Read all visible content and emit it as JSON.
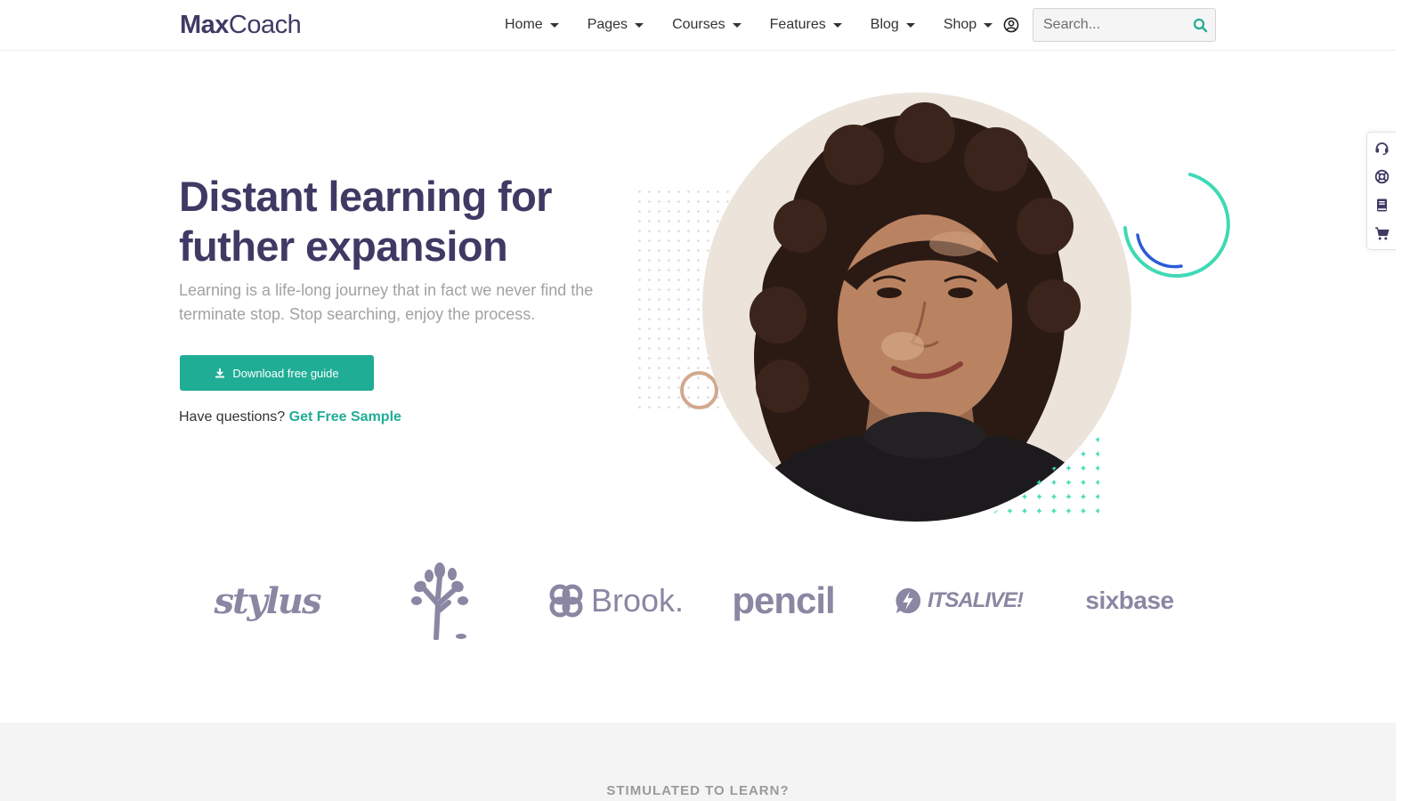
{
  "header": {
    "logo_bold": "Max",
    "logo_light": "Coach",
    "nav": [
      "Home",
      "Pages",
      "Courses",
      "Features",
      "Blog",
      "Shop"
    ],
    "search_placeholder": "Search..."
  },
  "hero": {
    "title_line1": "Distant learning for",
    "title_line2": "futher expansion",
    "subtitle": "Learning is a life-long journey that in fact we never find the terminate stop. Stop searching, enjoy the process.",
    "button_label": "Download free guide",
    "question_text": "Have questions?",
    "question_link": "Get Free Sample"
  },
  "brands": {
    "stylus": "stylus",
    "brook": "Brook.",
    "pencil": "pencil",
    "alive": "ITSALIVE!",
    "sixbase": "sixbase"
  },
  "lower": {
    "eyebrow": "STIMULATED TO LEARN?"
  },
  "colors": {
    "primary": "#20ad96",
    "heading": "#3f3a64",
    "muted": "#a2a2a2",
    "brand_gray": "#8a87a3",
    "photo_bg": "#ece4db"
  },
  "icons": {
    "user": "user-circle-icon",
    "search": "search-icon",
    "download": "download-icon",
    "side_tools": [
      "headset-icon",
      "lifebuoy-icon",
      "book-icon",
      "cart-icon"
    ]
  }
}
